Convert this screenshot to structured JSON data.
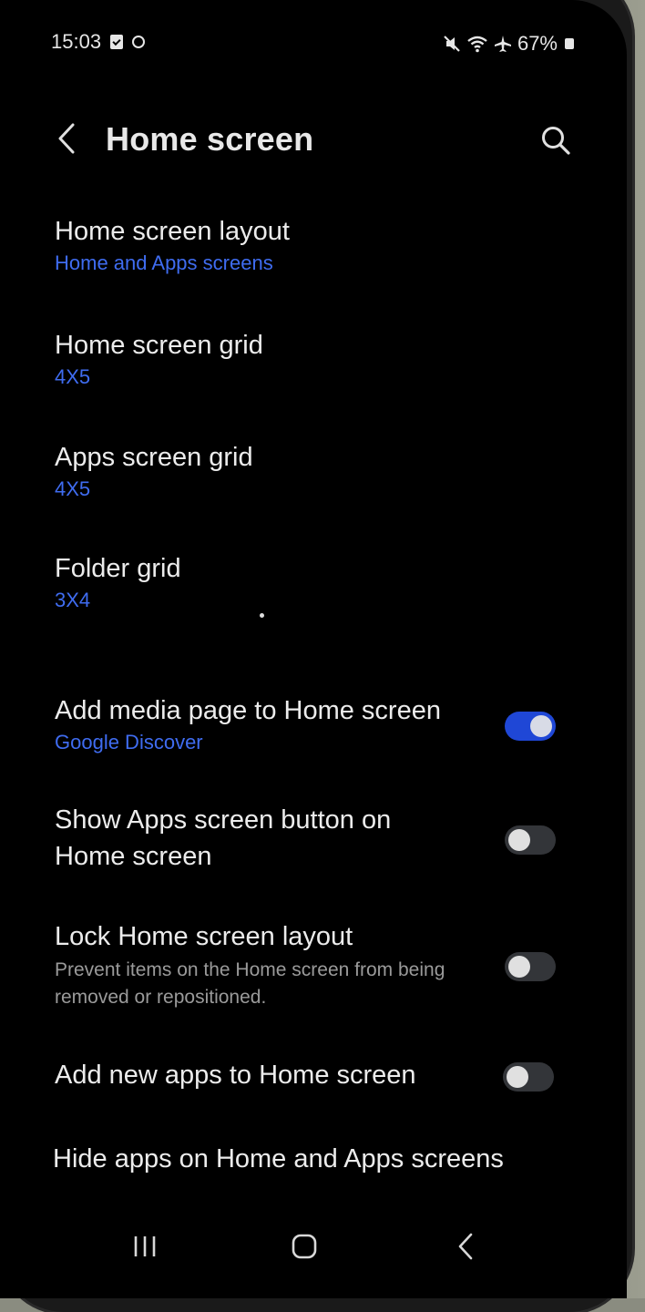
{
  "status_bar": {
    "time": "15:03",
    "battery": "67%",
    "icons": [
      "calendar-check-icon",
      "notification-dot-icon",
      "mute-icon",
      "wifi-icon",
      "airplane-icon",
      "battery-icon"
    ]
  },
  "header": {
    "title": "Home screen",
    "back_icon": "chevron-left-icon",
    "search_icon": "search-icon"
  },
  "settings": [
    {
      "title": "Home screen layout",
      "subtitle": "Home and Apps screens"
    },
    {
      "title": "Home screen grid",
      "subtitle": "4X5"
    },
    {
      "title": "Apps screen grid",
      "subtitle": "4X5"
    },
    {
      "title": "Folder grid",
      "subtitle": "3X4"
    }
  ],
  "toggles": [
    {
      "title": "Add media page to Home screen",
      "subtitle": "Google Discover",
      "on": true
    },
    {
      "title": "Show Apps screen button on Home screen",
      "on": false
    },
    {
      "title": "Lock Home screen layout",
      "description": "Prevent items on the Home screen from being removed or repositioned.",
      "on": false
    },
    {
      "title": "Add new apps to Home screen",
      "on": false
    }
  ],
  "hide_apps": {
    "title": "Hide apps on Home and Apps screens"
  },
  "colors": {
    "accent": "#3f6cf0",
    "toggle_on": "#1f47d6",
    "background": "#000000"
  },
  "navbar": {
    "icons": [
      "recents-icon",
      "home-icon",
      "back-icon"
    ]
  }
}
